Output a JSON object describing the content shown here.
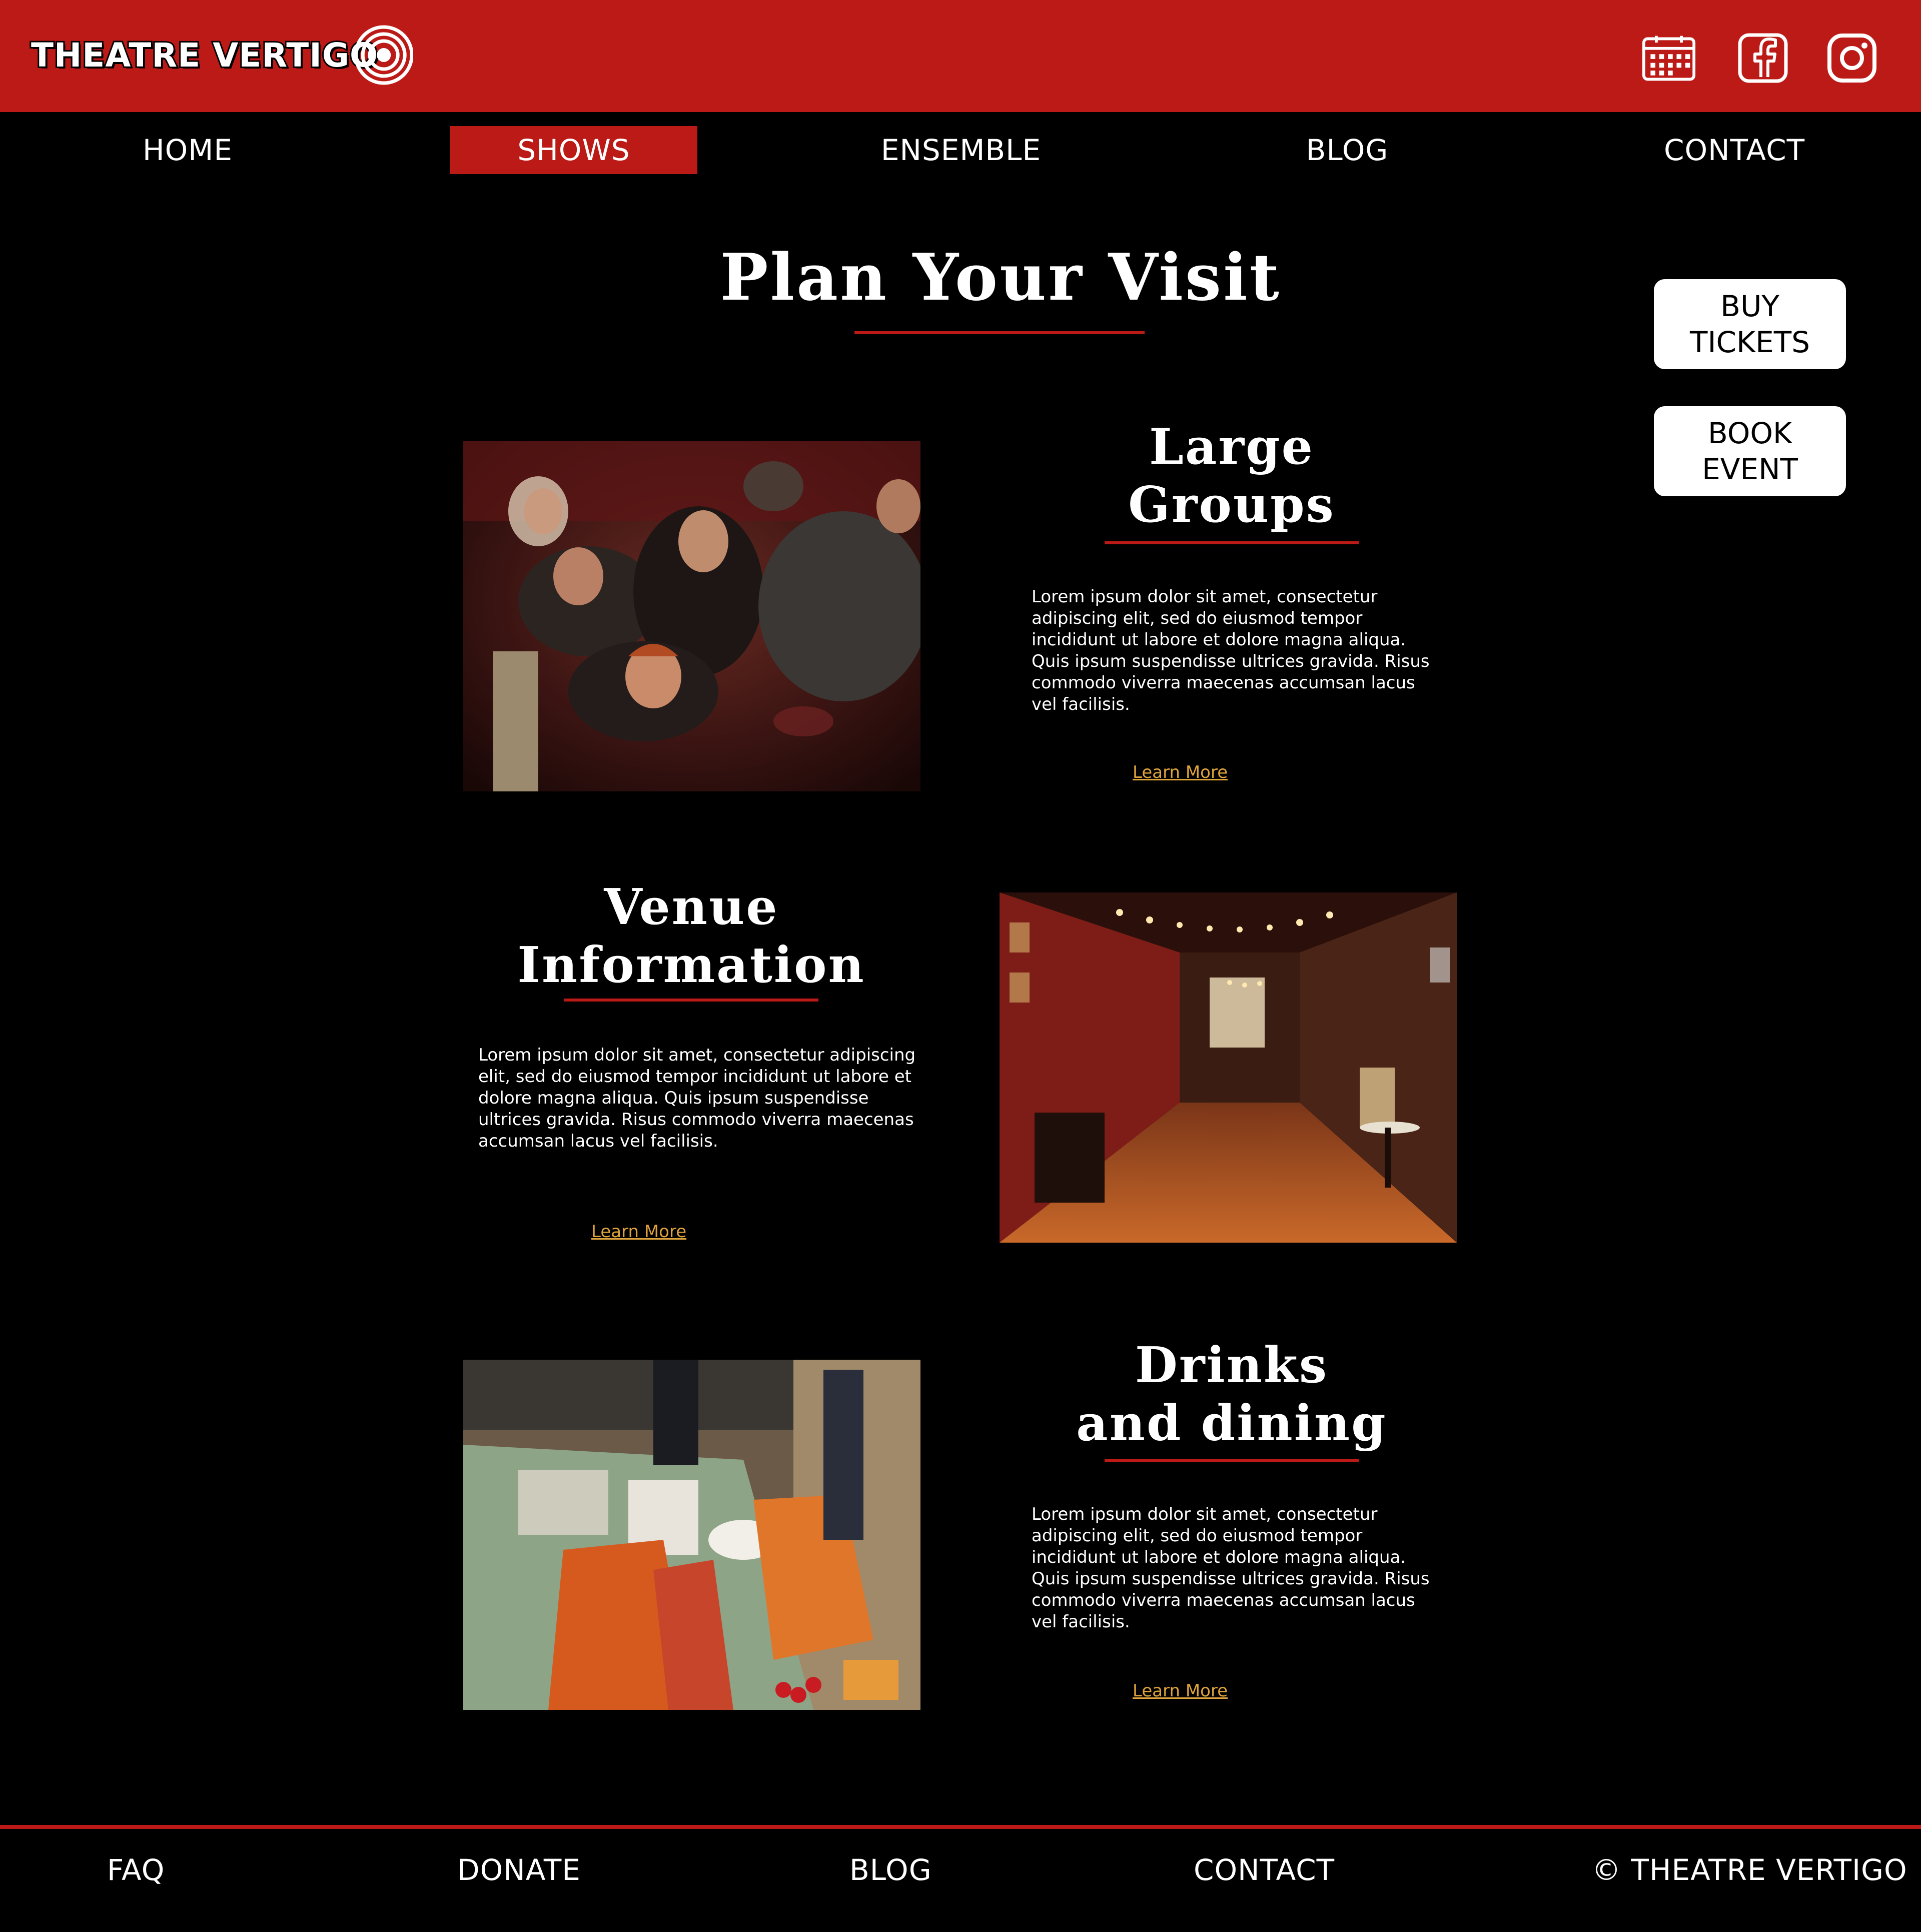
{
  "brand": {
    "name": "THEATRE VERTIGO",
    "accent": "#bb1a17",
    "link_color": "#e0a43c"
  },
  "header_icons": [
    {
      "icon": "calendar-icon"
    },
    {
      "icon": "facebook-icon"
    },
    {
      "icon": "instagram-icon"
    }
  ],
  "nav": {
    "items": [
      {
        "label": "HOME"
      },
      {
        "label": "SHOWS",
        "active": true
      },
      {
        "label": "ENSEMBLE"
      },
      {
        "label": "BLOG"
      },
      {
        "label": "CONTACT"
      }
    ]
  },
  "page_title": "Plan Your Visit",
  "side_buttons": [
    {
      "label": "BUY\nTICKETS"
    },
    {
      "label": "BOOK\nEVENT"
    }
  ],
  "sections": [
    {
      "title": "Large\nGroups",
      "body": "Lorem ipsum dolor sit amet, consectetur adipiscing elit, sed do eiusmod tempor incididunt ut labore et dolore magna aliqua. Quis ipsum suspendisse ultrices gravida. Risus commodo viverra maecenas accumsan lacus vel facilisis.",
      "link": "Learn More"
    },
    {
      "title": "Venue\nInformation",
      "body": "Lorem ipsum dolor sit amet, consectetur adipiscing elit, sed do eiusmod tempor incididunt ut labore et dolore magna aliqua. Quis ipsum suspendisse ultrices gravida. Risus commodo viverra maecenas accumsan lacus vel facilisis.",
      "link": "Learn More"
    },
    {
      "title": "Drinks\nand dining",
      "body": "Lorem ipsum dolor sit amet, consectetur adipiscing elit, sed do eiusmod tempor incididunt ut labore et dolore magna aliqua. Quis ipsum suspendisse ultrices gravida. Risus commodo viverra maecenas accumsan lacus vel facilisis.",
      "link": "Learn More"
    }
  ],
  "footer": {
    "items": [
      {
        "label": "FAQ"
      },
      {
        "label": "DONATE"
      },
      {
        "label": "BLOG"
      },
      {
        "label": "CONTACT"
      },
      {
        "label": "© THEATRE VERTIGO"
      }
    ]
  }
}
